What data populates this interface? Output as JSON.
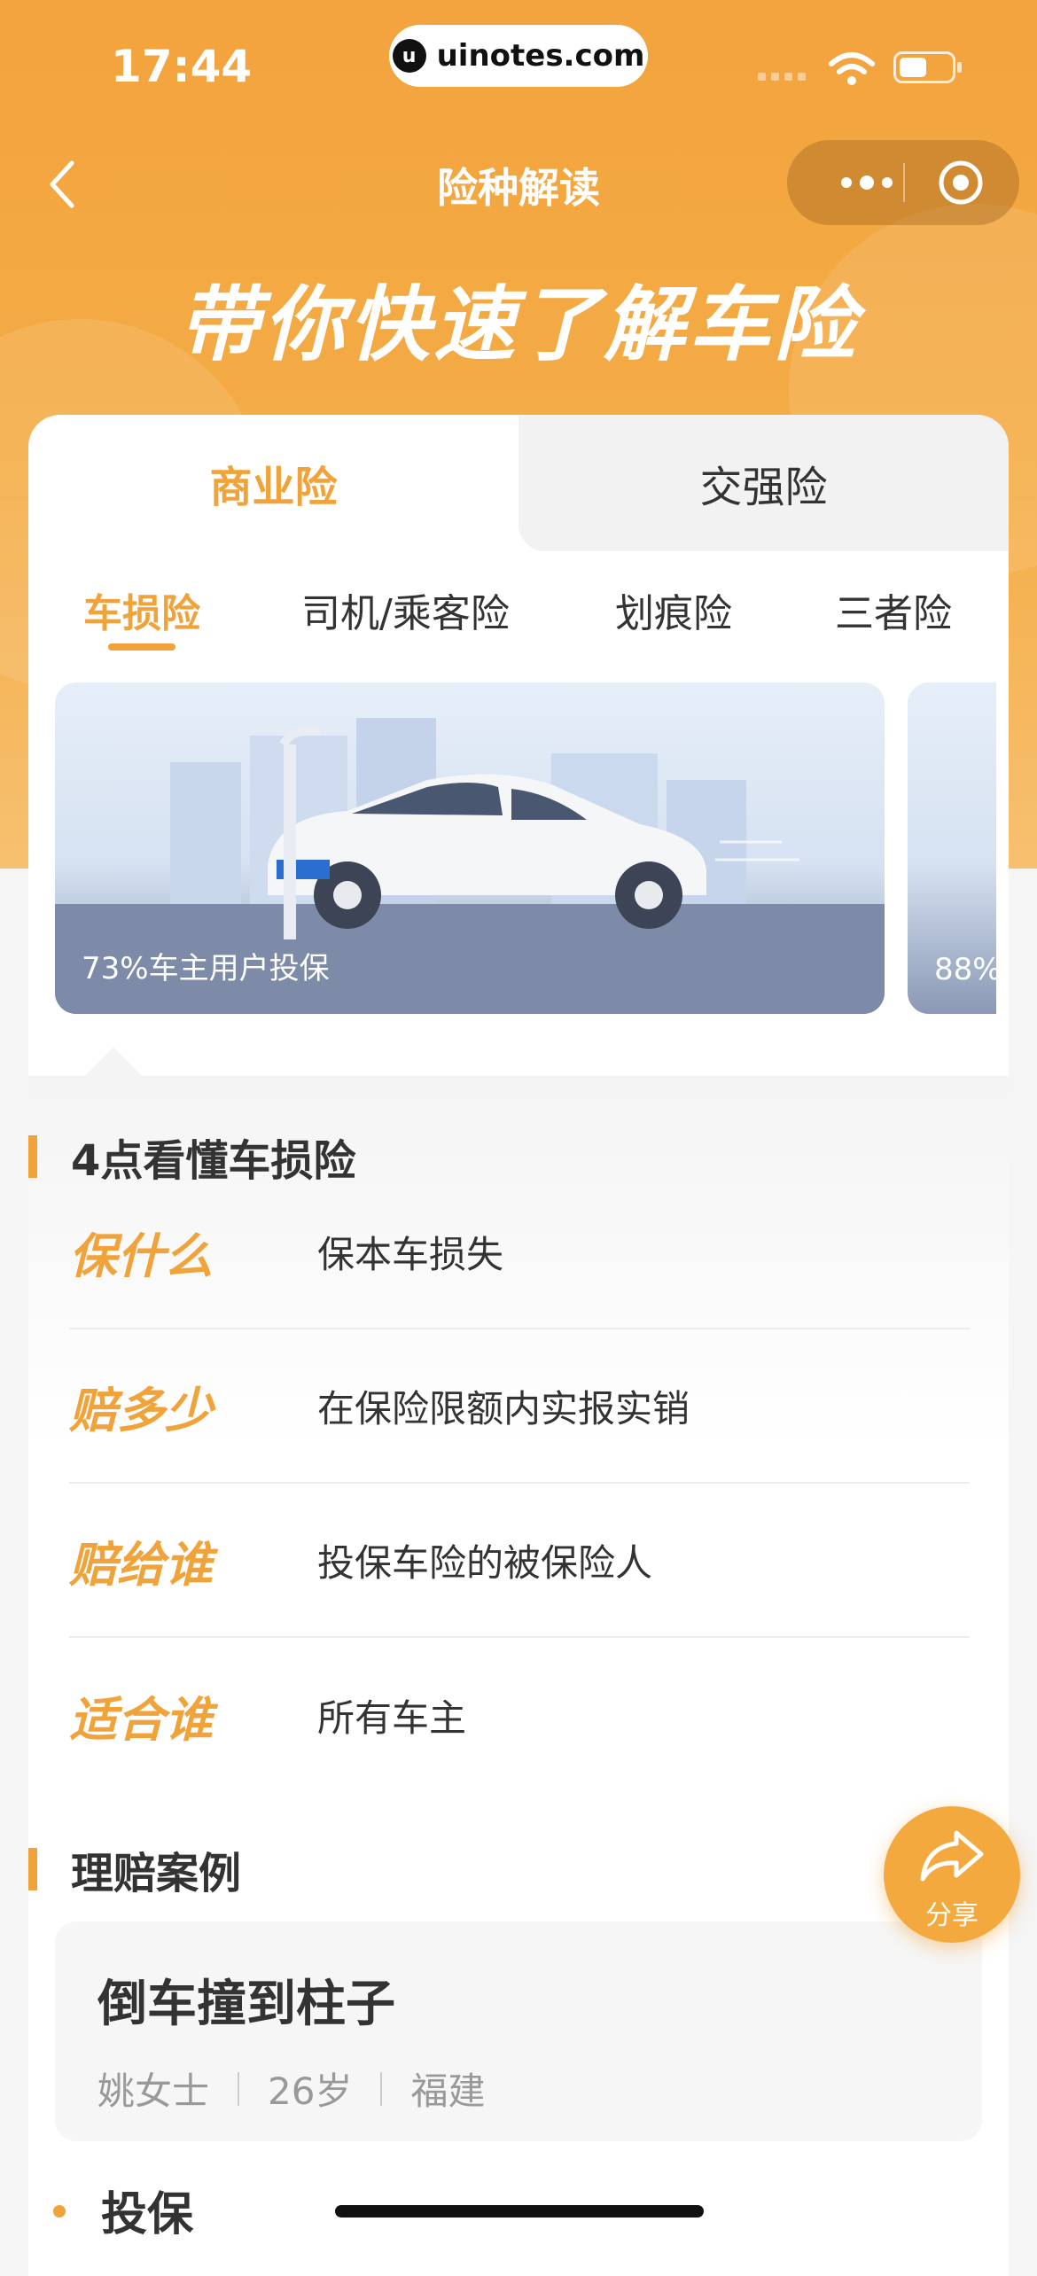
{
  "status_bar": {
    "time": "17:44",
    "url": "uinotes.com"
  },
  "nav": {
    "title": "险种解读"
  },
  "hero": {
    "title": "带你快速了解车险"
  },
  "main_tabs": [
    {
      "label": "商业险",
      "active": true
    },
    {
      "label": "交强险",
      "active": false
    }
  ],
  "sub_tabs": [
    {
      "label": "车损险",
      "active": true
    },
    {
      "label": "司机/乘客险",
      "active": false
    },
    {
      "label": "划痕险",
      "active": false
    },
    {
      "label": "三者险",
      "active": false
    }
  ],
  "banners": [
    {
      "caption": "73%车主用户投保"
    },
    {
      "caption": "88%"
    }
  ],
  "section_points": {
    "title": "4点看懂车损险",
    "rows": [
      {
        "key": "保什么",
        "value": "保本车损失"
      },
      {
        "key": "赔多少",
        "value": "在保险限额内实报实销"
      },
      {
        "key": "赔给谁",
        "value": "投保车险的被保险人"
      },
      {
        "key": "适合谁",
        "value": "所有车主"
      }
    ]
  },
  "section_cases": {
    "title": "理赔案例",
    "case": {
      "title": "倒车撞到柱子",
      "name": "姚女士",
      "age": "26岁",
      "location": "福建"
    }
  },
  "next_item": {
    "label": "投保"
  },
  "share": {
    "label": "分享"
  },
  "colors": {
    "accent": "#f0a33a",
    "hero_bg": "#f3a33d"
  }
}
